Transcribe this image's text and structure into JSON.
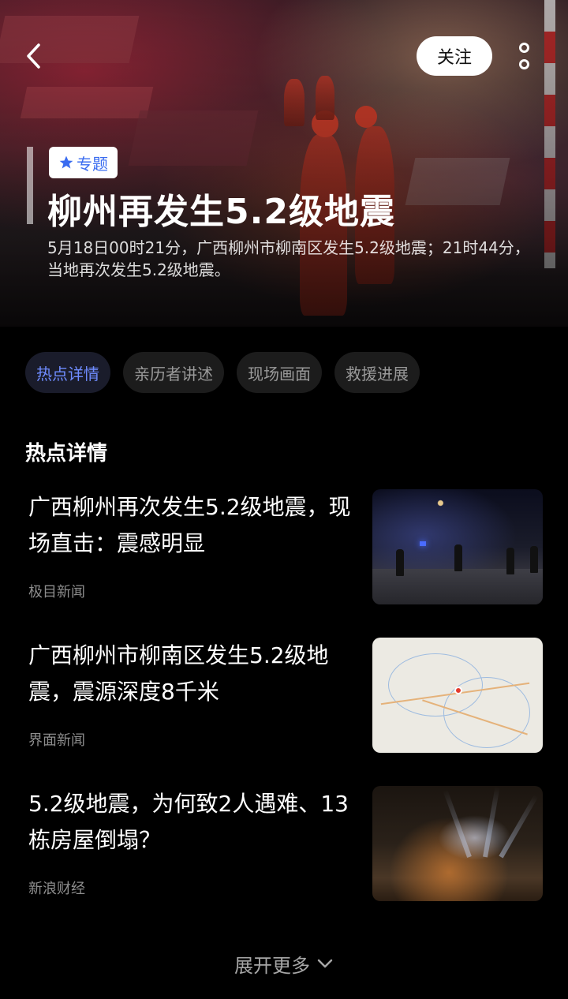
{
  "header": {
    "follow_label": "关注",
    "topic_tag": "专题",
    "title": "柳州再发生5.2级地震",
    "description": "5月18日00时21分，广西柳州市柳南区发生5.2级地震；21时44分，当地再次发生5.2级地震。"
  },
  "tabs": [
    {
      "label": "热点详情",
      "active": true
    },
    {
      "label": "亲历者讲述",
      "active": false
    },
    {
      "label": "现场画面",
      "active": false
    },
    {
      "label": "救援进展",
      "active": false
    }
  ],
  "section": {
    "title": "热点详情"
  },
  "news": [
    {
      "title": "广西柳州再次发生5.2级地震，现场直击：震感明显",
      "source": "极目新闻",
      "thumbnail": "night-street-photo"
    },
    {
      "title": "广西柳州市柳南区发生5.2级地震，震源深度8千米",
      "source": "界面新闻",
      "thumbnail": "epicenter-map"
    },
    {
      "title": "5.2级地震，为何致2人遇难、13栋房屋倒塌？",
      "source": "新浪财经",
      "thumbnail": "rescue-rubble-photo"
    }
  ],
  "footer": {
    "expand_label": "展开更多"
  },
  "colors": {
    "accent": "#6f8cff",
    "tag_blue": "#3a6cf0",
    "background": "#000000"
  }
}
